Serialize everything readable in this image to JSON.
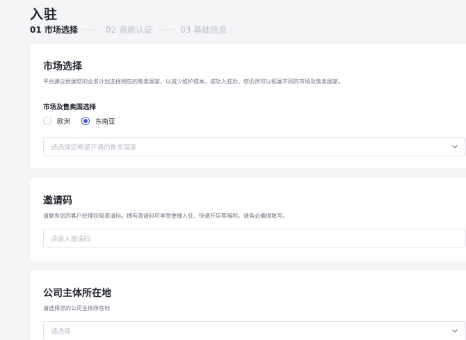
{
  "page": {
    "title": "入驻"
  },
  "steps": [
    {
      "label": "01 市场选择",
      "active": true
    },
    {
      "label": "02 资质认证",
      "active": false
    },
    {
      "label": "03 基础信息",
      "active": false
    }
  ],
  "step_separator": "·····",
  "market": {
    "title": "市场选择",
    "description": "平台建议根据您的业务计划选择相应的售卖国家，以减少维护成本。成功入驻后，您仍然可以拓展不同的市场及售卖国家。",
    "field_label": "市场及售卖国选择",
    "options": [
      {
        "label": "欧洲",
        "checked": false
      },
      {
        "label": "东南亚",
        "checked": true
      }
    ],
    "country_select_placeholder": "请选择您希望开通的售卖国家"
  },
  "invite": {
    "title": "邀请码",
    "description": "请联系您的客户经理获取邀请码。拥有邀请码可享受便捷入驻、快速开店等福利，请务必确保填写。",
    "input_placeholder": "请输入邀请码"
  },
  "entity": {
    "title": "公司主体所在地",
    "description": "请选择您的公司主体所在地",
    "select_placeholder": "请选择"
  },
  "colors": {
    "accent": "#4856d8",
    "background": "#f4f5f7"
  }
}
